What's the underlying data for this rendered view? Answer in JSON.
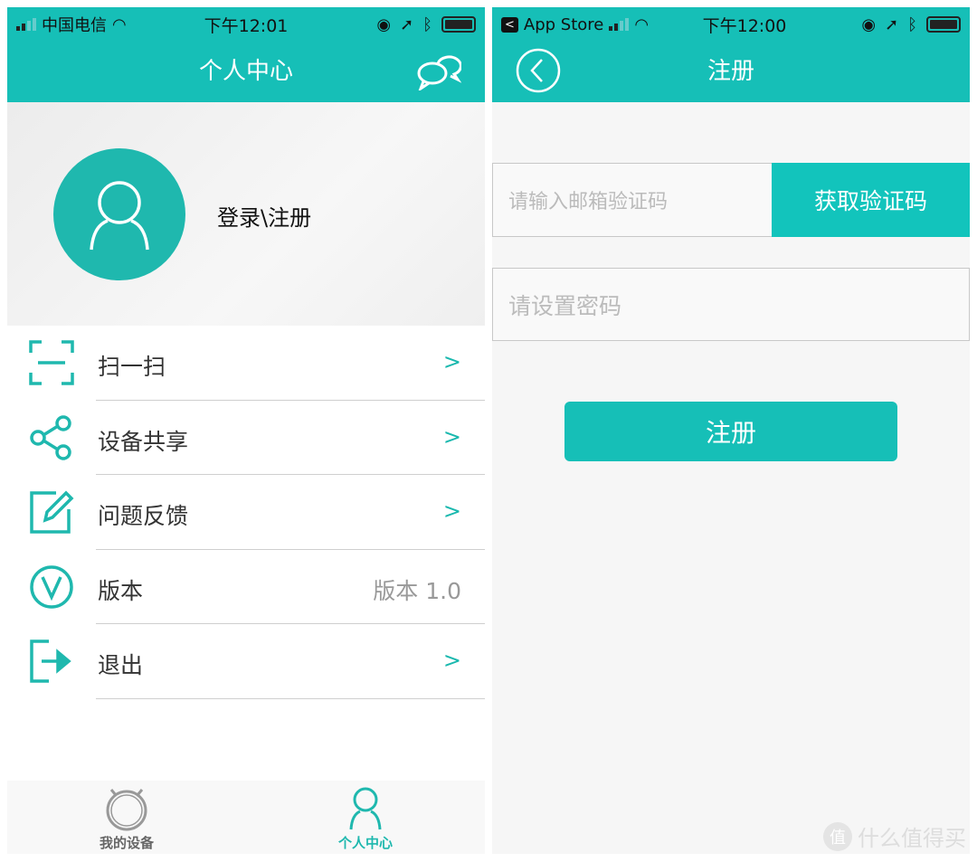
{
  "left": {
    "status": {
      "carrier": "中国电信",
      "time": "下午12:01"
    },
    "header": {
      "title": "个人中心",
      "message_icon": "chat-bubbles-icon"
    },
    "profile": {
      "login_label": "登录\\注册"
    },
    "menu": [
      {
        "label": "扫一扫",
        "icon": "scan-icon"
      },
      {
        "label": "设备共享",
        "icon": "share-icon"
      },
      {
        "label": "问题反馈",
        "icon": "edit-icon"
      },
      {
        "label": "版本",
        "icon": "version-icon",
        "value": "版本 1.0"
      },
      {
        "label": "退出",
        "icon": "logout-icon"
      }
    ],
    "tabs": [
      {
        "label": "我的设备",
        "active": false
      },
      {
        "label": "个人中心",
        "active": true
      }
    ]
  },
  "right": {
    "status": {
      "back_app": "App Store",
      "time": "下午12:00"
    },
    "header": {
      "title": "注册"
    },
    "form": {
      "code_placeholder": "请输入邮箱验证码",
      "get_code_label": "获取验证码",
      "password_placeholder": "请设置密码",
      "submit_label": "注册"
    }
  },
  "watermark": {
    "text": "什么值得买",
    "badge": "值"
  },
  "colors": {
    "accent": "#16bfb7",
    "active_tab": "#1fb8ae",
    "inactive_tab": "#888888"
  }
}
